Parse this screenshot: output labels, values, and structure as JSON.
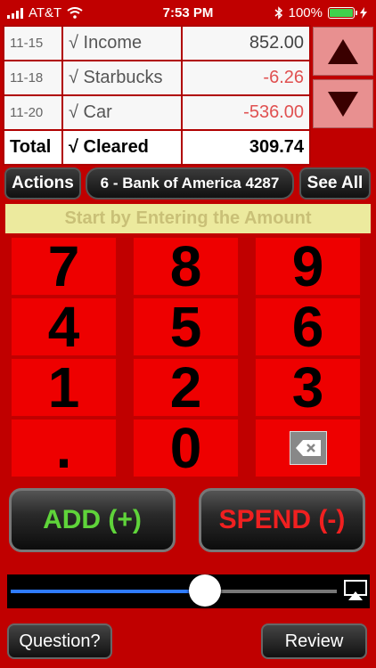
{
  "status_bar": {
    "carrier": "AT&T",
    "time": "7:53 PM",
    "battery": "100%"
  },
  "transactions": [
    {
      "date": "11-15",
      "desc": "√ Income",
      "amount": "852.00",
      "type": "pos"
    },
    {
      "date": "11-18",
      "desc": "√ Starbucks",
      "amount": "-6.26",
      "type": "neg"
    },
    {
      "date": "11-20",
      "desc": "√ Car",
      "amount": "-536.00",
      "type": "neg"
    }
  ],
  "total": {
    "label": "Total",
    "desc": "√ Cleared",
    "amount": "309.74"
  },
  "toolbar": {
    "actions": "Actions",
    "account": "6 - Bank of America 4287",
    "see_all": "See All"
  },
  "hint": "Start by Entering the Amount",
  "keypad": [
    "7",
    "8",
    "9",
    "4",
    "5",
    "6",
    "1",
    "2",
    "3",
    ".",
    "0"
  ],
  "buttons": {
    "add": "ADD (+)",
    "spend": "SPEND (-)",
    "question": "Question?",
    "review": "Review"
  },
  "colors": {
    "background": "#c00000",
    "add_text": "#5fd43a",
    "spend_text": "#f02020",
    "key": "#ee0000",
    "hint_bg": "#ecea9e"
  },
  "slider": {
    "value": 0.55
  },
  "icons": [
    "wifi-icon",
    "bluetooth-icon",
    "battery-icon",
    "charging-icon",
    "arrow-up-icon",
    "arrow-down-icon",
    "backspace-icon",
    "airplay-icon"
  ]
}
